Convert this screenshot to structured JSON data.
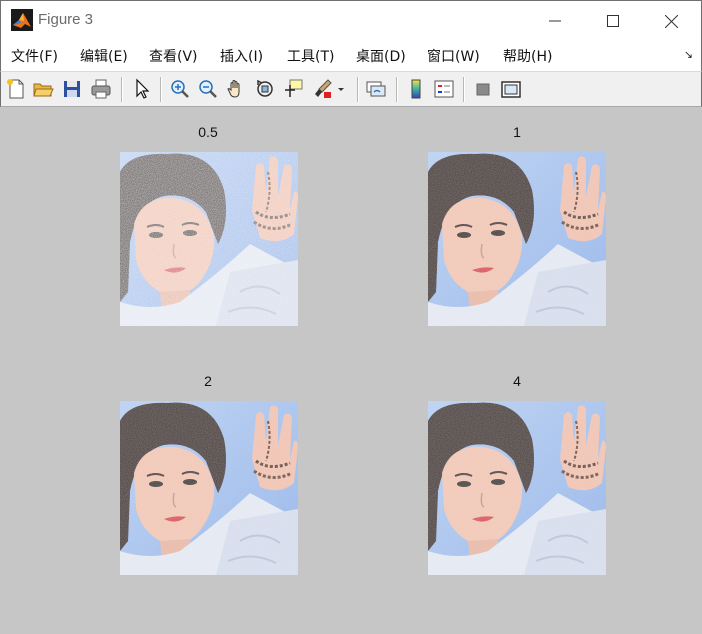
{
  "window": {
    "title": "Figure 3"
  },
  "menu": [
    {
      "label": "文件(F)"
    },
    {
      "label": "编辑(E)"
    },
    {
      "label": "查看(V)"
    },
    {
      "label": "插入(I)"
    },
    {
      "label": "工具(T)"
    },
    {
      "label": "桌面(D)"
    },
    {
      "label": "窗口(W)"
    },
    {
      "label": "帮助(H)"
    }
  ],
  "toolbar": {
    "icons": [
      "new-figure-icon",
      "open-file-icon",
      "save-icon",
      "print-icon",
      "pointer-icon",
      "zoom-in-icon",
      "zoom-out-icon",
      "pan-hand-icon",
      "rotate-3d-icon",
      "data-cursor-icon",
      "brush-icon",
      "link-plot-icon",
      "colorbar-icon",
      "legend-icon",
      "hide-plot-tools-icon",
      "show-plot-tools-icon"
    ]
  },
  "subplots": [
    {
      "title": "0.5",
      "noise": "high"
    },
    {
      "title": "1",
      "noise": "low"
    },
    {
      "title": "2",
      "noise": "low"
    },
    {
      "title": "4",
      "noise": "low"
    }
  ]
}
